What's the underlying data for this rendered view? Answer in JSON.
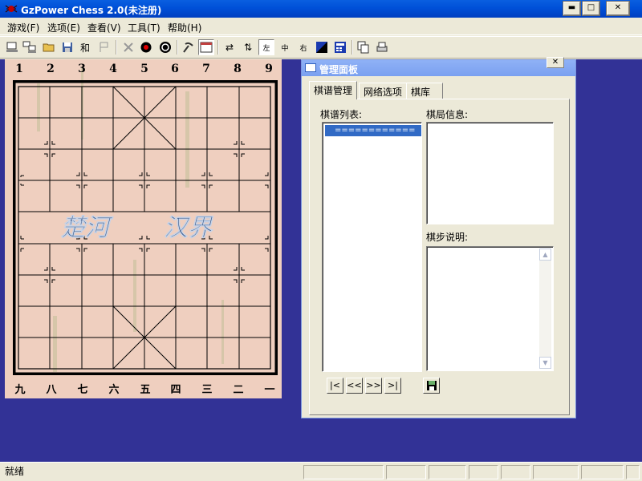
{
  "window": {
    "title": "GzPower Chess 2.0(未注册)"
  },
  "menu": [
    "游戏(F)",
    "选项(E)",
    "查看(V)",
    "工具(T)",
    "帮助(H)"
  ],
  "toolbar": {
    "text_buttons": [
      "和",
      "左",
      "中",
      "右"
    ]
  },
  "board": {
    "top_labels": [
      "1",
      "2",
      "3",
      "4",
      "5",
      "6",
      "7",
      "8",
      "9"
    ],
    "bottom_labels": [
      "九",
      "八",
      "七",
      "六",
      "五",
      "四",
      "三",
      "二",
      "一"
    ],
    "river_left": "楚河",
    "river_right": "汉界"
  },
  "panel": {
    "title": "管理面板",
    "tabs": [
      "棋谱管理",
      "网络选项",
      "棋库"
    ],
    "record_list_label": "棋谱列表:",
    "record_list_items": [
      "============"
    ],
    "game_info_label": "棋局信息:",
    "move_notes_label": "棋步说明:",
    "nav": [
      "|<",
      "<<",
      ">>",
      ">|"
    ]
  },
  "status": {
    "text": "就绪"
  },
  "colors": {
    "workspace": "#323296",
    "board": "#efcfbf",
    "title_bar": "#0054e3"
  }
}
